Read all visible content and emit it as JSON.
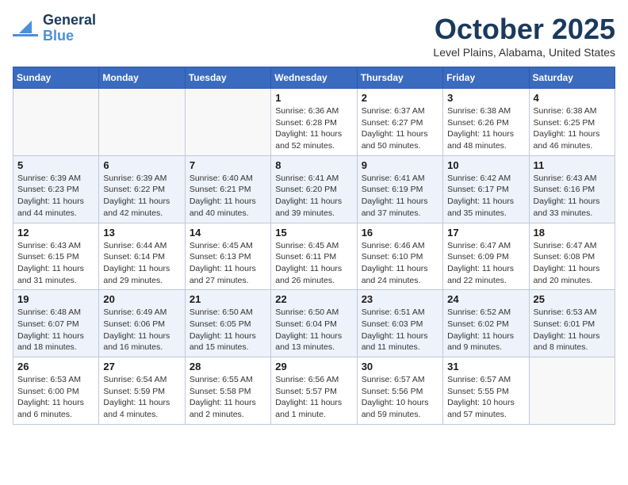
{
  "header": {
    "logo_general": "General",
    "logo_blue": "Blue",
    "month_title": "October 2025",
    "location": "Level Plains, Alabama, United States"
  },
  "days_of_week": [
    "Sunday",
    "Monday",
    "Tuesday",
    "Wednesday",
    "Thursday",
    "Friday",
    "Saturday"
  ],
  "weeks": [
    [
      {
        "day": "",
        "info": ""
      },
      {
        "day": "",
        "info": ""
      },
      {
        "day": "",
        "info": ""
      },
      {
        "day": "1",
        "info": "Sunrise: 6:36 AM\nSunset: 6:28 PM\nDaylight: 11 hours and 52 minutes."
      },
      {
        "day": "2",
        "info": "Sunrise: 6:37 AM\nSunset: 6:27 PM\nDaylight: 11 hours and 50 minutes."
      },
      {
        "day": "3",
        "info": "Sunrise: 6:38 AM\nSunset: 6:26 PM\nDaylight: 11 hours and 48 minutes."
      },
      {
        "day": "4",
        "info": "Sunrise: 6:38 AM\nSunset: 6:25 PM\nDaylight: 11 hours and 46 minutes."
      }
    ],
    [
      {
        "day": "5",
        "info": "Sunrise: 6:39 AM\nSunset: 6:23 PM\nDaylight: 11 hours and 44 minutes."
      },
      {
        "day": "6",
        "info": "Sunrise: 6:39 AM\nSunset: 6:22 PM\nDaylight: 11 hours and 42 minutes."
      },
      {
        "day": "7",
        "info": "Sunrise: 6:40 AM\nSunset: 6:21 PM\nDaylight: 11 hours and 40 minutes."
      },
      {
        "day": "8",
        "info": "Sunrise: 6:41 AM\nSunset: 6:20 PM\nDaylight: 11 hours and 39 minutes."
      },
      {
        "day": "9",
        "info": "Sunrise: 6:41 AM\nSunset: 6:19 PM\nDaylight: 11 hours and 37 minutes."
      },
      {
        "day": "10",
        "info": "Sunrise: 6:42 AM\nSunset: 6:17 PM\nDaylight: 11 hours and 35 minutes."
      },
      {
        "day": "11",
        "info": "Sunrise: 6:43 AM\nSunset: 6:16 PM\nDaylight: 11 hours and 33 minutes."
      }
    ],
    [
      {
        "day": "12",
        "info": "Sunrise: 6:43 AM\nSunset: 6:15 PM\nDaylight: 11 hours and 31 minutes."
      },
      {
        "day": "13",
        "info": "Sunrise: 6:44 AM\nSunset: 6:14 PM\nDaylight: 11 hours and 29 minutes."
      },
      {
        "day": "14",
        "info": "Sunrise: 6:45 AM\nSunset: 6:13 PM\nDaylight: 11 hours and 27 minutes."
      },
      {
        "day": "15",
        "info": "Sunrise: 6:45 AM\nSunset: 6:11 PM\nDaylight: 11 hours and 26 minutes."
      },
      {
        "day": "16",
        "info": "Sunrise: 6:46 AM\nSunset: 6:10 PM\nDaylight: 11 hours and 24 minutes."
      },
      {
        "day": "17",
        "info": "Sunrise: 6:47 AM\nSunset: 6:09 PM\nDaylight: 11 hours and 22 minutes."
      },
      {
        "day": "18",
        "info": "Sunrise: 6:47 AM\nSunset: 6:08 PM\nDaylight: 11 hours and 20 minutes."
      }
    ],
    [
      {
        "day": "19",
        "info": "Sunrise: 6:48 AM\nSunset: 6:07 PM\nDaylight: 11 hours and 18 minutes."
      },
      {
        "day": "20",
        "info": "Sunrise: 6:49 AM\nSunset: 6:06 PM\nDaylight: 11 hours and 16 minutes."
      },
      {
        "day": "21",
        "info": "Sunrise: 6:50 AM\nSunset: 6:05 PM\nDaylight: 11 hours and 15 minutes."
      },
      {
        "day": "22",
        "info": "Sunrise: 6:50 AM\nSunset: 6:04 PM\nDaylight: 11 hours and 13 minutes."
      },
      {
        "day": "23",
        "info": "Sunrise: 6:51 AM\nSunset: 6:03 PM\nDaylight: 11 hours and 11 minutes."
      },
      {
        "day": "24",
        "info": "Sunrise: 6:52 AM\nSunset: 6:02 PM\nDaylight: 11 hours and 9 minutes."
      },
      {
        "day": "25",
        "info": "Sunrise: 6:53 AM\nSunset: 6:01 PM\nDaylight: 11 hours and 8 minutes."
      }
    ],
    [
      {
        "day": "26",
        "info": "Sunrise: 6:53 AM\nSunset: 6:00 PM\nDaylight: 11 hours and 6 minutes."
      },
      {
        "day": "27",
        "info": "Sunrise: 6:54 AM\nSunset: 5:59 PM\nDaylight: 11 hours and 4 minutes."
      },
      {
        "day": "28",
        "info": "Sunrise: 6:55 AM\nSunset: 5:58 PM\nDaylight: 11 hours and 2 minutes."
      },
      {
        "day": "29",
        "info": "Sunrise: 6:56 AM\nSunset: 5:57 PM\nDaylight: 11 hours and 1 minute."
      },
      {
        "day": "30",
        "info": "Sunrise: 6:57 AM\nSunset: 5:56 PM\nDaylight: 10 hours and 59 minutes."
      },
      {
        "day": "31",
        "info": "Sunrise: 6:57 AM\nSunset: 5:55 PM\nDaylight: 10 hours and 57 minutes."
      },
      {
        "day": "",
        "info": ""
      }
    ]
  ]
}
